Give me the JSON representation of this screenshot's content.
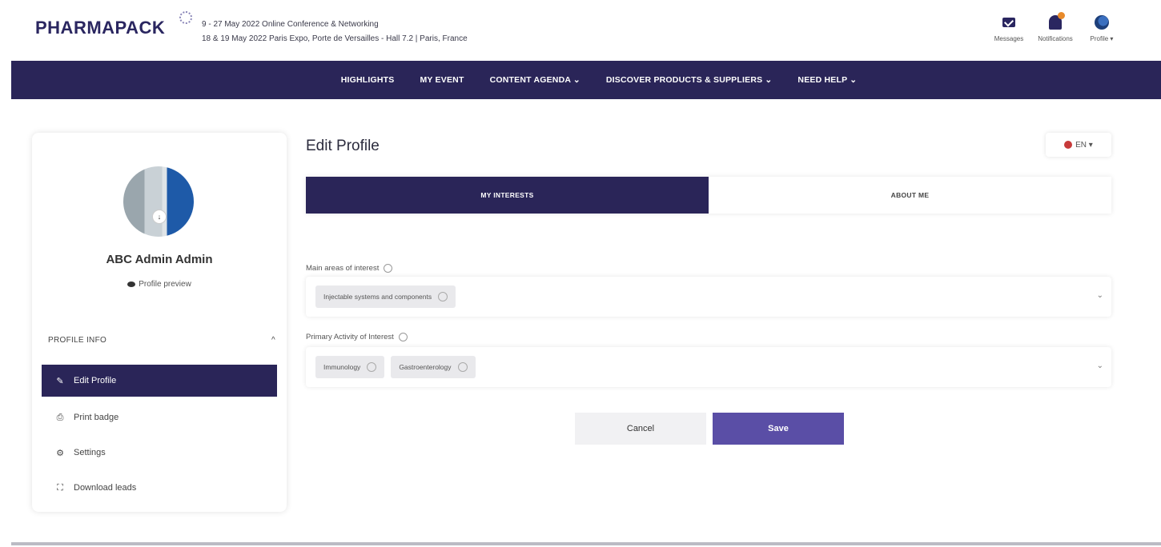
{
  "header": {
    "logo": "PHARMAPACK",
    "event_line1": "9 - 27 May 2022 Online Conference & Networking",
    "event_line2": "18 & 19 May 2022 Paris Expo, Porte de Versailles - Hall 7.2 | Paris, France",
    "messages_label": "Messages",
    "notifications_label": "Notifications",
    "profile_label": "Profile ▾"
  },
  "nav": {
    "items": [
      "HIGHLIGHTS",
      "MY EVENT",
      "CONTENT AGENDA ⌄",
      "DISCOVER PRODUCTS & SUPPLIERS ⌄",
      "NEED HELP ⌄"
    ]
  },
  "sidebar": {
    "user_name": "ABC Admin Admin",
    "preview_label": "Profile preview",
    "section_title": "PROFILE INFO",
    "section_chevron": "^",
    "menu": [
      {
        "label": "Edit Profile",
        "icon": "✎",
        "active": true
      },
      {
        "label": "Print badge",
        "icon": "⎙",
        "active": false
      },
      {
        "label": "Settings",
        "icon": "⚙",
        "active": false
      },
      {
        "label": "Download leads",
        "icon": "⛶",
        "active": false
      }
    ]
  },
  "main": {
    "title": "Edit Profile",
    "language": "EN ▾",
    "tabs": [
      "MY INTERESTS",
      "ABOUT ME"
    ],
    "field1": {
      "label": "Main areas of interest",
      "chips": [
        "Injectable systems and components"
      ]
    },
    "field2": {
      "label": "Primary Activity of Interest",
      "chips": [
        "Immunology",
        "Gastroenterology"
      ]
    },
    "cancel_label": "Cancel",
    "save_label": "Save"
  },
  "colors": {
    "nav_bg": "#2a2558",
    "save_bg": "#5a4ea6",
    "accent_orange": "#e88a2a"
  }
}
